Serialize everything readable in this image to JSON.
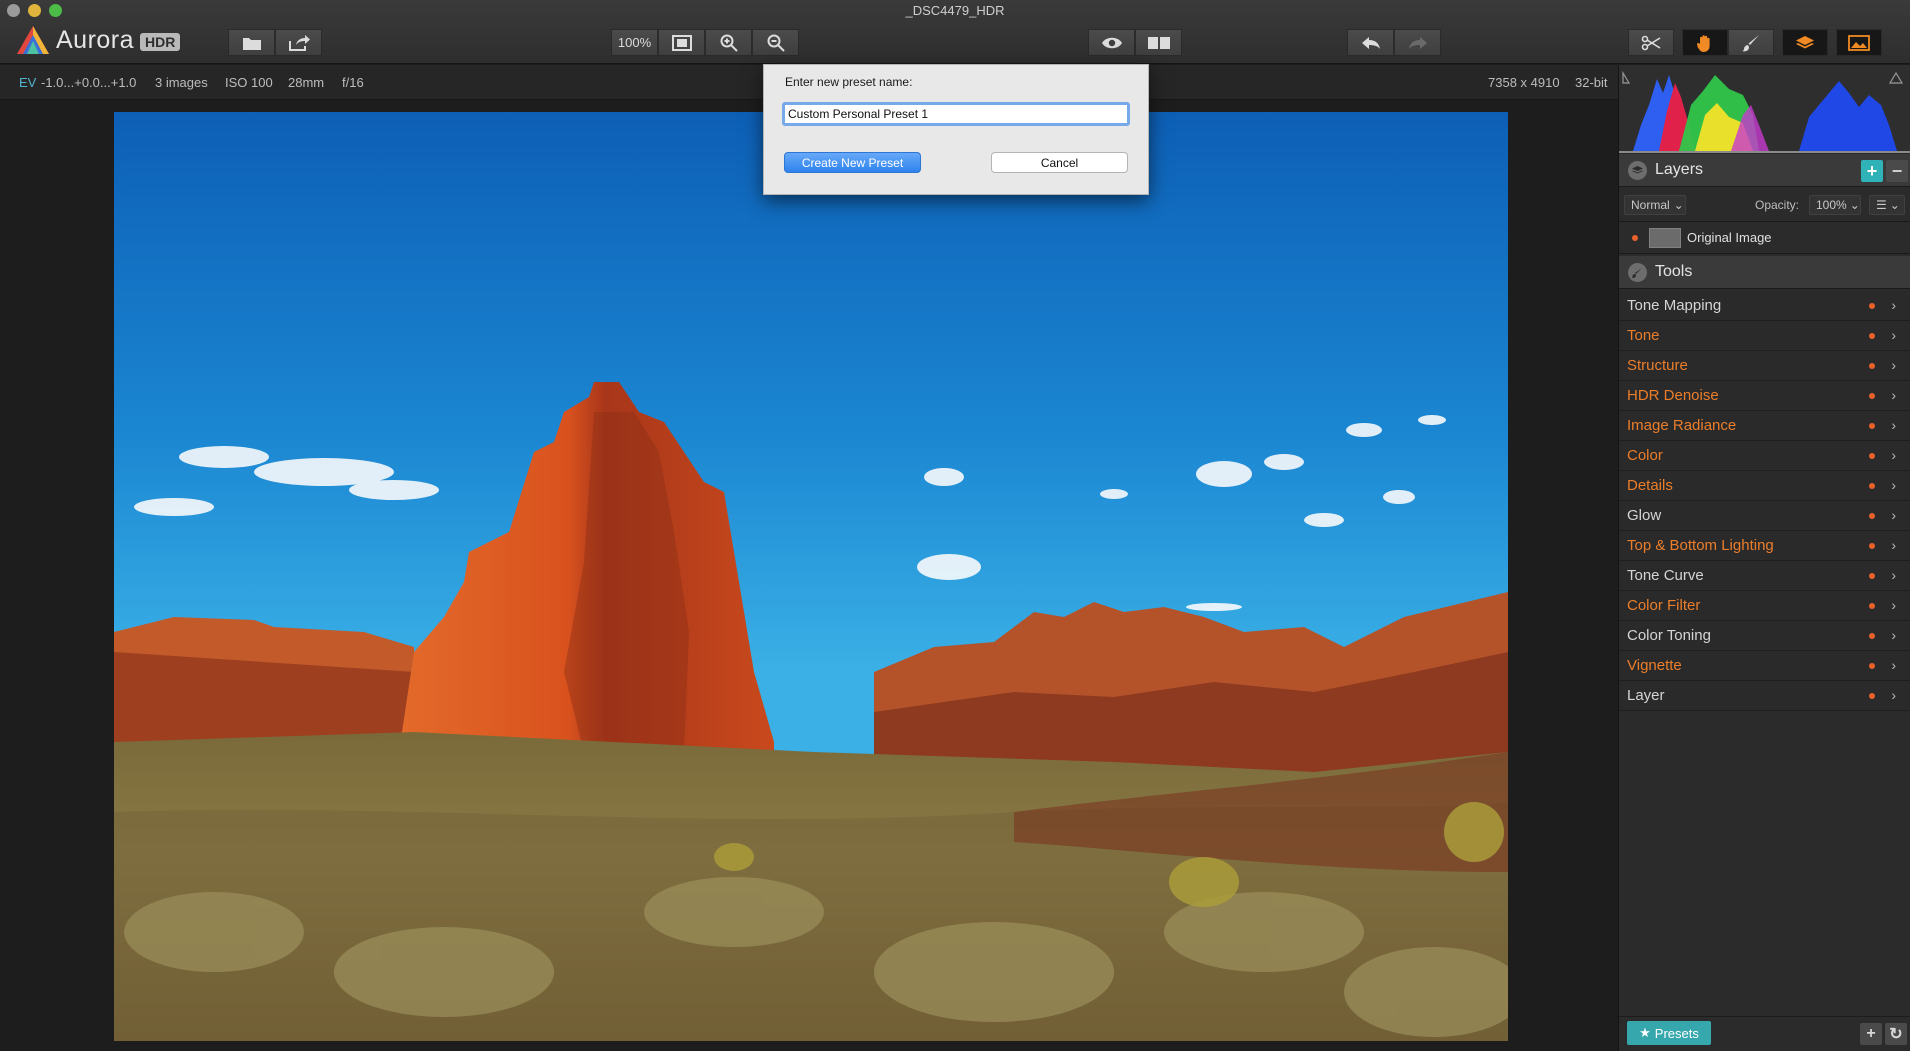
{
  "window": {
    "title": "_DSC4479_HDR"
  },
  "logo": {
    "name": "Aurora",
    "badge": "HDR"
  },
  "toolbar": {
    "zoom_label": "100%",
    "icons": [
      "open-file-icon",
      "share-icon",
      "fit-screen-icon",
      "zoom-in-icon",
      "zoom-out-icon",
      "eye-icon",
      "compare-icon",
      "undo-icon",
      "redo-icon",
      "crop-icon",
      "hand-icon",
      "brush-icon",
      "layers-icon",
      "image-icon"
    ]
  },
  "infobar": {
    "ev_label": "EV",
    "ev_value": "-1.0...+0.0...+1.0",
    "images": "3 images",
    "iso": "ISO 100",
    "focal": "28mm",
    "aperture": "f/16",
    "dimensions": "7358 x 4910",
    "bitdepth": "32-bit"
  },
  "dialog": {
    "prompt": "Enter new preset name:",
    "input_value": "Custom Personal Preset 1",
    "create_label": "Create New Preset",
    "cancel_label": "Cancel",
    "accent": "#2f83ee"
  },
  "layers": {
    "title": "Layers",
    "add_label": "+",
    "remove_label": "−",
    "blend_mode": "Normal",
    "opacity_label": "Opacity:",
    "opacity_value": "100%",
    "menu_label": "☰",
    "rows": [
      {
        "name": "Original Image"
      }
    ]
  },
  "tools": {
    "title": "Tools",
    "items": [
      {
        "label": "Tone Mapping",
        "active": false
      },
      {
        "label": "Tone",
        "active": true
      },
      {
        "label": "Structure",
        "active": true
      },
      {
        "label": "HDR Denoise",
        "active": true
      },
      {
        "label": "Image Radiance",
        "active": true
      },
      {
        "label": "Color",
        "active": true
      },
      {
        "label": "Details",
        "active": true
      },
      {
        "label": "Glow",
        "active": false
      },
      {
        "label": "Top & Bottom Lighting",
        "active": true
      },
      {
        "label": "Tone Curve",
        "active": false
      },
      {
        "label": "Color Filter",
        "active": true
      },
      {
        "label": "Color Toning",
        "active": false
      },
      {
        "label": "Vignette",
        "active": true
      },
      {
        "label": "Layer",
        "active": false
      }
    ],
    "active_color": "#ec7e2a"
  },
  "footer": {
    "presets_label": "Presets",
    "add_label": "+",
    "refresh_label": "↻"
  }
}
